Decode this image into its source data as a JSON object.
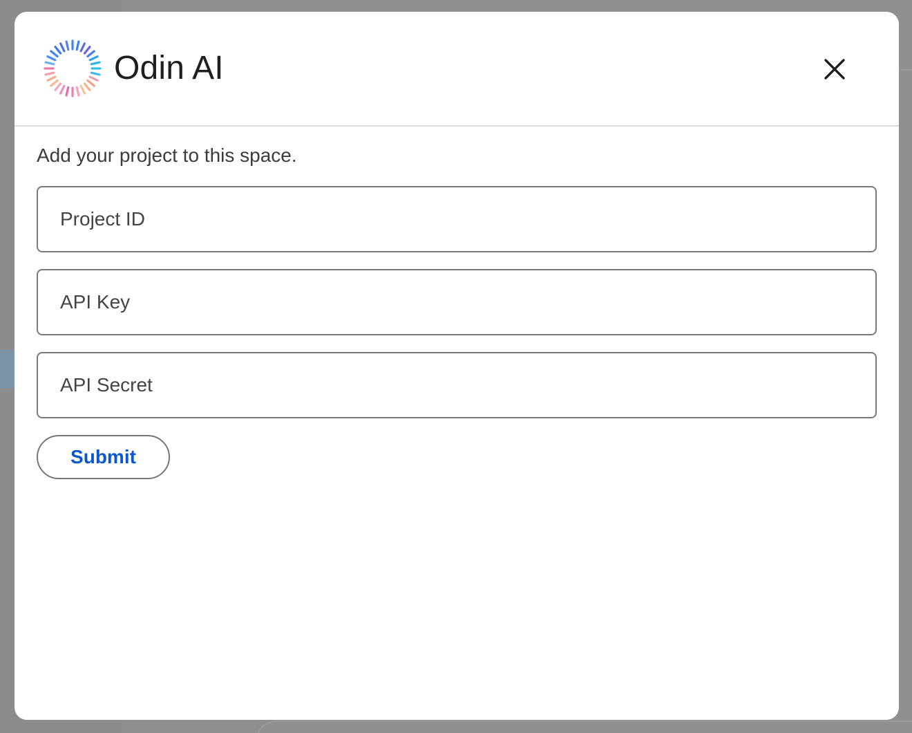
{
  "dialog": {
    "brand_name": "Odin AI",
    "instruction": "Add your project to this space.",
    "fields": {
      "project_id_placeholder": "Project ID",
      "api_key_placeholder": "API Key",
      "api_secret_placeholder": "API Secret"
    },
    "submit_label": "Submit",
    "icons": {
      "logo": "odin-sunburst-logo",
      "close": "close-icon"
    },
    "colors": {
      "submit_text": "#0b57d0",
      "text_primary": "#1f1f1f",
      "field_border": "#7a7a7a"
    }
  }
}
